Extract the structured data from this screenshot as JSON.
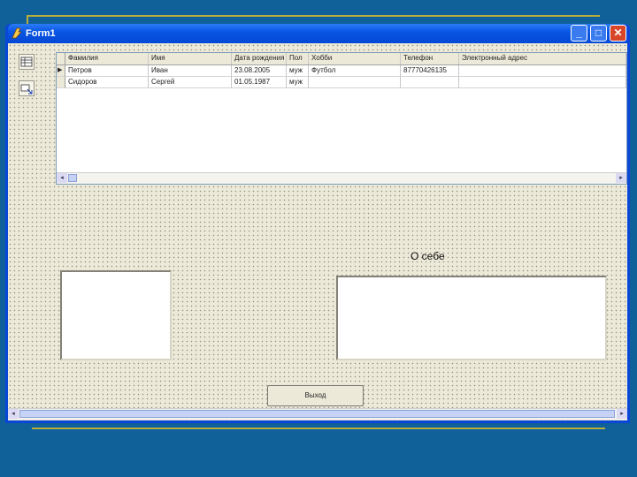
{
  "window": {
    "title": "Form1",
    "minimize_glyph": "_",
    "maximize_glyph": "□",
    "close_glyph": "✕"
  },
  "grid": {
    "columns": [
      "Фамилия",
      "Имя",
      "Дата рождения",
      "Пол",
      "Хобби",
      "Телефон",
      "Электронный адрес"
    ],
    "rows": [
      [
        "Петров",
        "Иван",
        "23.08.2005",
        "муж",
        "Футбол",
        "87770426135",
        ""
      ],
      [
        "Сидоров",
        "Сергей",
        "01.05.1987",
        "муж",
        "",
        "",
        ""
      ]
    ],
    "current_row_indicator": "▶",
    "scroll_left_glyph": "◂",
    "scroll_right_glyph": "▸"
  },
  "form": {
    "about_label": "О себе",
    "exit_button_label": "Выход"
  },
  "icons": {
    "app": "delphi-app-icon",
    "component1": "dbgrid-component-icon",
    "component2": "dbnavigator-component-icon"
  }
}
